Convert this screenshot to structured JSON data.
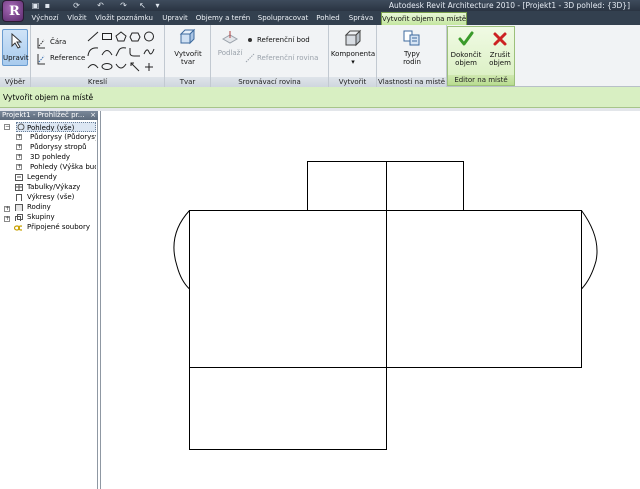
{
  "title": "Autodesk Revit Architecture 2010 - [Projekt1 - 3D pohled: {3D}]",
  "app_button_glyph": "R",
  "tabs": [
    "Výchozí",
    "Vložit",
    "Vložit poznámku",
    "Upravit",
    "Objemy a terén",
    "Spolupracovat",
    "Pohled",
    "Správa",
    "Vytvořit objem na místě"
  ],
  "active_tab": "Vytvořit objem na místě",
  "ribbon": {
    "select": {
      "button": "Upravit",
      "label": "Výběr"
    },
    "draw": {
      "line": "Čára",
      "reference": "Reference",
      "label": "Kreslí"
    },
    "form": {
      "button_line1": "Vytvořit",
      "button_line2": "tvar",
      "label": "Tvar"
    },
    "workplane": {
      "floor": "Podlaží",
      "ref_point": "Referenční bod",
      "ref_plane": "Referenční rovina",
      "label": "Srovnávací rovina"
    },
    "create": {
      "component": "Komponenta",
      "label": "Vytvořit"
    },
    "properties": {
      "button_line1": "Typy",
      "button_line2": "rodin",
      "label": "Vlastnosti na místě"
    },
    "editor": {
      "finish_line1": "Dokončit",
      "finish_line2": "objem",
      "cancel_line1": "Zrušit",
      "cancel_line2": "objem",
      "label": "Editor na místě"
    }
  },
  "options_bar": "Vytvořit objem na místě",
  "browser": {
    "title": "Projekt1 - Prohlížeč pr...",
    "close": "×",
    "items": [
      {
        "label": "Pohledy (vše)",
        "level": 0,
        "toggle": "−",
        "selected": true
      },
      {
        "label": "Půdorysy (Půdorysy)",
        "level": 1,
        "toggle": "+"
      },
      {
        "label": "Půdorysy stropů",
        "level": 1,
        "toggle": "+"
      },
      {
        "label": "3D pohledy",
        "level": 1,
        "toggle": "+"
      },
      {
        "label": "Pohledy (Výška budovy)",
        "level": 1,
        "toggle": "+"
      },
      {
        "label": "Legendy",
        "level": 0,
        "toggle": ""
      },
      {
        "label": "Tabulky/Výkazy",
        "level": 0,
        "toggle": ""
      },
      {
        "label": "Výkresy (vše)",
        "level": 0,
        "toggle": ""
      },
      {
        "label": "Rodiny",
        "level": 0,
        "toggle": "+"
      },
      {
        "label": "Skupiny",
        "level": 0,
        "toggle": "+"
      },
      {
        "label": "Připojené soubory",
        "level": 0,
        "toggle": ""
      }
    ]
  },
  "colors": {
    "accent_green": "#d8efc2",
    "ok_green": "#3a9a2a",
    "cancel_red": "#cc2222",
    "title_bg": "#2f3a48"
  }
}
